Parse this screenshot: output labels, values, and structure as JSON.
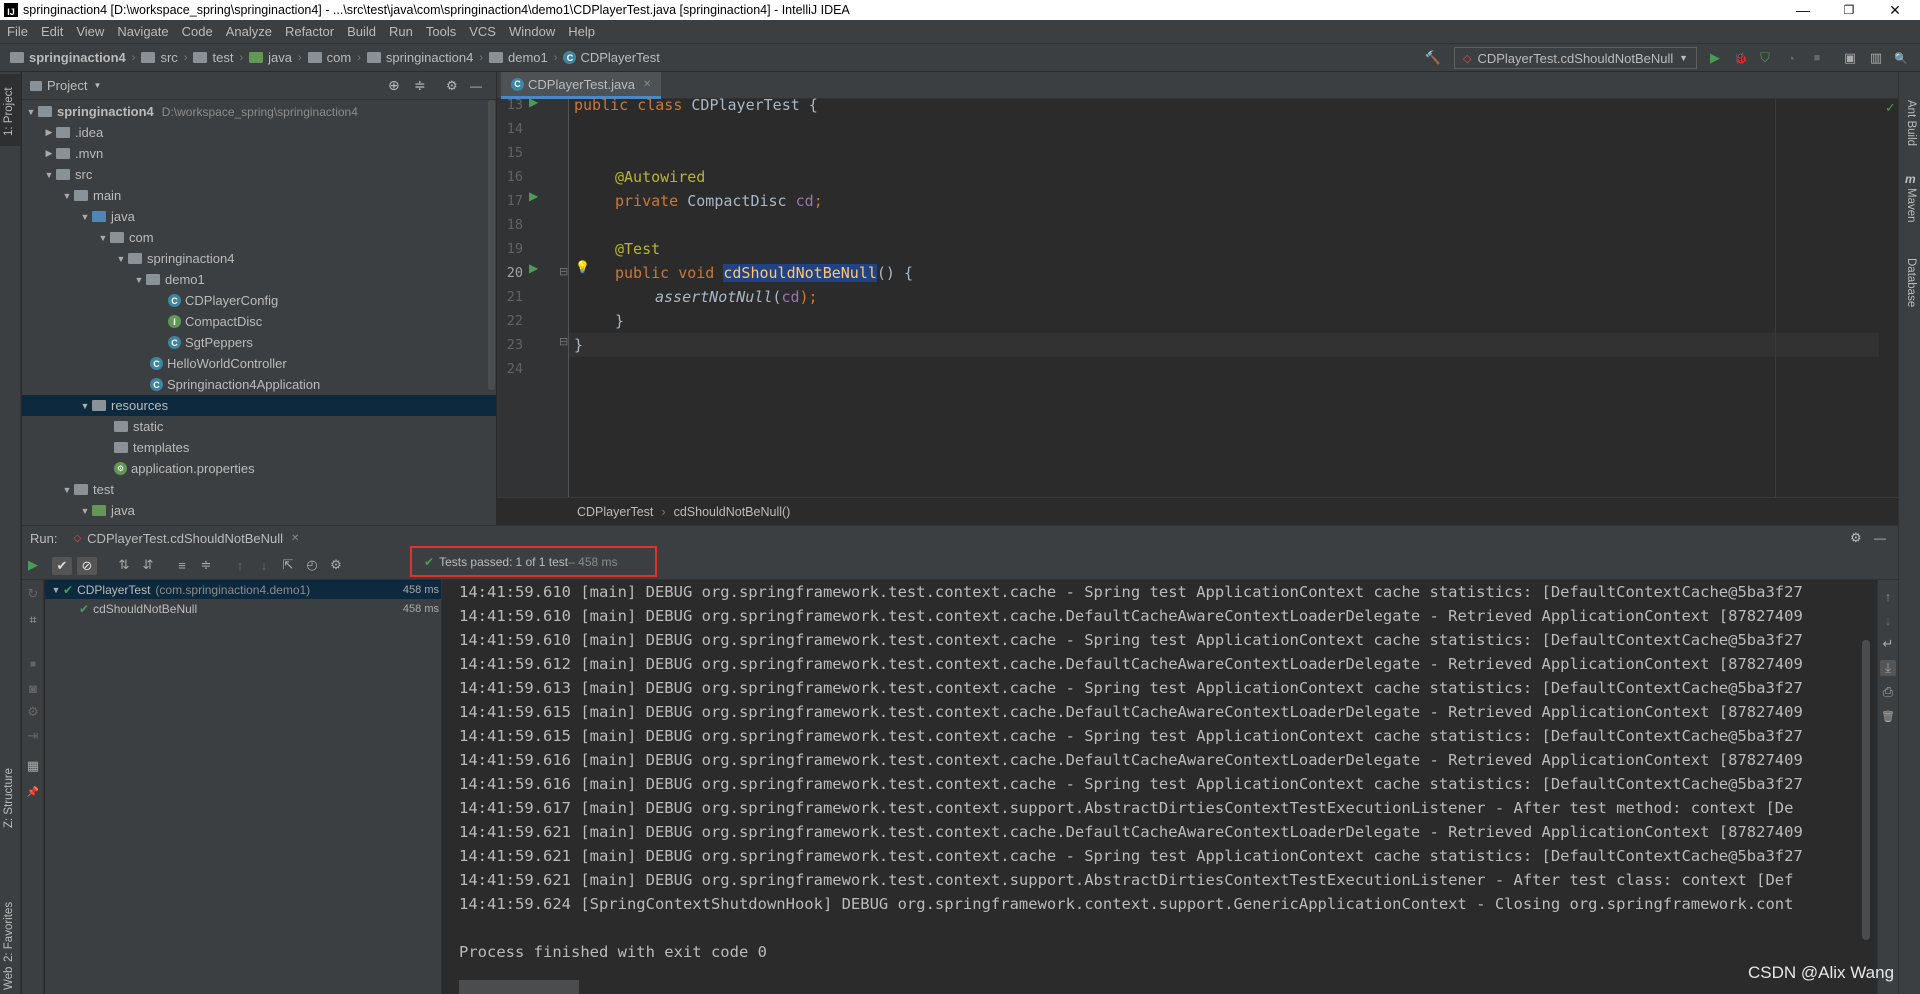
{
  "window": {
    "title": "springinaction4 [D:\\workspace_spring\\springinaction4] - ...\\src\\test\\java\\com\\springinaction4\\demo1\\CDPlayerTest.java [springinaction4] - IntelliJ IDEA",
    "logo_label": "IJ",
    "controls": {
      "minimize": "—",
      "maximize": "❐",
      "close": "✕"
    }
  },
  "menu": [
    "File",
    "Edit",
    "View",
    "Navigate",
    "Code",
    "Analyze",
    "Refactor",
    "Build",
    "Run",
    "Tools",
    "VCS",
    "Window",
    "Help"
  ],
  "breadcrumbs": [
    "springinaction4",
    "src",
    "test",
    "java",
    "com",
    "springinaction4",
    "demo1",
    "CDPlayerTest"
  ],
  "run_config": {
    "label": "CDPlayerTest.cdShouldNotBeNull",
    "icon": "◇",
    "dropdown": "▼"
  },
  "toolbar_icons": {
    "hammer": "🔨",
    "run": "▶",
    "debug": "🐞",
    "coverage": "⛉",
    "profile": "◔",
    "stop": "■",
    "project_structure": "▣",
    "layout": "▥",
    "settings": "⚙",
    "search": "🔍"
  },
  "left_strip": {
    "project": "1: Project",
    "structure": "Z: Structure",
    "favorites": "2: Favorites",
    "web": "Web"
  },
  "right_strip": {
    "ant": "Ant Build",
    "maven": "Maven",
    "database": "Database",
    "m_letter": "m"
  },
  "project_panel": {
    "title": "Project",
    "dropdown": "▼",
    "icons": {
      "target": "⊕",
      "collapse": "≑",
      "settings": "⚙",
      "hide": "—"
    },
    "tree": [
      {
        "arrow": "▼",
        "label": "springinaction4",
        "hint": "D:\\workspace_spring\\springinaction4",
        "kind": "module"
      },
      {
        "arrow": "▶",
        "label": ".idea",
        "kind": "folder"
      },
      {
        "arrow": "▶",
        "label": ".mvn",
        "kind": "folder"
      },
      {
        "arrow": "▼",
        "label": "src",
        "kind": "folder"
      },
      {
        "arrow": "▼",
        "label": "main",
        "kind": "folder"
      },
      {
        "arrow": "▼",
        "label": "java",
        "kind": "folder-blue"
      },
      {
        "arrow": "▼",
        "label": "com",
        "kind": "folder"
      },
      {
        "arrow": "▼",
        "label": "springinaction4",
        "kind": "folder"
      },
      {
        "arrow": "▼",
        "label": "demo1",
        "kind": "folder"
      },
      {
        "arrow": "",
        "label": "CDPlayerConfig",
        "kind": "class",
        "glyph": "C"
      },
      {
        "arrow": "",
        "label": "CompactDisc",
        "kind": "interface",
        "glyph": "I"
      },
      {
        "arrow": "",
        "label": "SgtPeppers",
        "kind": "class",
        "glyph": "C"
      },
      {
        "arrow": "",
        "label": "HelloWorldController",
        "kind": "class",
        "glyph": "C"
      },
      {
        "arrow": "",
        "label": "Springinaction4Application",
        "kind": "class",
        "glyph": "C"
      },
      {
        "arrow": "▼",
        "label": "resources",
        "kind": "folder",
        "selected": true
      },
      {
        "arrow": "",
        "label": "static",
        "kind": "folder"
      },
      {
        "arrow": "",
        "label": "templates",
        "kind": "folder"
      },
      {
        "arrow": "",
        "label": "application.properties",
        "kind": "file"
      },
      {
        "arrow": "▼",
        "label": "test",
        "kind": "folder"
      },
      {
        "arrow": "▼",
        "label": "java",
        "kind": "folder-blue"
      }
    ]
  },
  "editor": {
    "tab_label": "CDPlayerTest.java",
    "tab_close": "✕",
    "line_numbers": [
      "13",
      "14",
      "15",
      "16",
      "17",
      "18",
      "19",
      "20",
      "21",
      "22",
      "23",
      "24"
    ],
    "code": {
      "l13_kw1": "public ",
      "l13_kw2": "class ",
      "l13_rest": "CDPlayerTest {",
      "l16": "@Autowired",
      "l17_kw": "private ",
      "l17_type": "CompactDisc ",
      "l17_field": "cd",
      "l17_end": ";",
      "l19": "@Test",
      "l20_kw": "public void ",
      "l20_name": "cdShouldNotBeNull",
      "l20_end": "() {",
      "l21_call": "assertNotNull",
      "l21_open": "(",
      "l21_arg": "cd",
      "l21_end": ");",
      "l22": "}",
      "l23": "}"
    },
    "gutter_marks": {
      "run": "▶",
      "fold": "⊟",
      "bulb": "💡",
      "ok": "✓"
    },
    "breadcrumb": [
      "CDPlayerTest",
      "cdShouldNotBeNull()"
    ],
    "breadcrumb_sep": "›"
  },
  "run_panel": {
    "label": "Run:",
    "tab": "CDPlayerTest.cdShouldNotBeNull",
    "tab_close": "✕",
    "header_icons": {
      "settings": "⚙",
      "hide": "—"
    },
    "status_icon": "✔",
    "status_text": "Tests passed: ",
    "status_count": "1 of 1 test",
    "status_time": " – 458 ms",
    "toolbar_icons": {
      "run": "▶",
      "check": "✔",
      "stop": "⊘",
      "sort_alpha": "⇅",
      "sort_dur": "⇵",
      "expand": "≡",
      "collapse": "≑",
      "prev": "↑",
      "next": "↓",
      "export": "⇱",
      "history": "◴",
      "settings": "⚙"
    },
    "side_icons": {
      "rerun": "↻",
      "toggle": "⌗",
      "stop": "■",
      "camera": "◙",
      "gear": "⚙",
      "exit": "⇥",
      "layout": "▦",
      "pin": "📌"
    },
    "console_icons": {
      "up": "↑",
      "down": "↓",
      "wrap": "↵",
      "scroll_end": "⤓",
      "print": "⎙",
      "trash": "🗑"
    },
    "tests": [
      {
        "icon": "✔",
        "label": "CDPlayerTest",
        "pkg": "(com.springinaction4.demo1)",
        "time": "458 ms",
        "arrow": "▼"
      },
      {
        "icon": "✔",
        "label": "cdShouldNotBeNull",
        "time": "458 ms"
      }
    ],
    "console": [
      "14:41:59.610 [main] DEBUG org.springframework.test.context.cache - Spring test ApplicationContext cache statistics: [DefaultContextCache@5ba3f27",
      "14:41:59.610 [main] DEBUG org.springframework.test.context.cache.DefaultCacheAwareContextLoaderDelegate - Retrieved ApplicationContext [87827409",
      "14:41:59.610 [main] DEBUG org.springframework.test.context.cache - Spring test ApplicationContext cache statistics: [DefaultContextCache@5ba3f27",
      "14:41:59.612 [main] DEBUG org.springframework.test.context.cache.DefaultCacheAwareContextLoaderDelegate - Retrieved ApplicationContext [87827409",
      "14:41:59.613 [main] DEBUG org.springframework.test.context.cache - Spring test ApplicationContext cache statistics: [DefaultContextCache@5ba3f27",
      "14:41:59.615 [main] DEBUG org.springframework.test.context.cache.DefaultCacheAwareContextLoaderDelegate - Retrieved ApplicationContext [87827409",
      "14:41:59.615 [main] DEBUG org.springframework.test.context.cache - Spring test ApplicationContext cache statistics: [DefaultContextCache@5ba3f27",
      "14:41:59.616 [main] DEBUG org.springframework.test.context.cache.DefaultCacheAwareContextLoaderDelegate - Retrieved ApplicationContext [87827409",
      "14:41:59.616 [main] DEBUG org.springframework.test.context.cache - Spring test ApplicationContext cache statistics: [DefaultContextCache@5ba3f27",
      "14:41:59.617 [main] DEBUG org.springframework.test.context.support.AbstractDirtiesContextTestExecutionListener - After test method: context [De",
      "14:41:59.621 [main] DEBUG org.springframework.test.context.cache.DefaultCacheAwareContextLoaderDelegate - Retrieved ApplicationContext [87827409",
      "14:41:59.621 [main] DEBUG org.springframework.test.context.cache - Spring test ApplicationContext cache statistics: [DefaultContextCache@5ba3f27",
      "14:41:59.621 [main] DEBUG org.springframework.test.context.support.AbstractDirtiesContextTestExecutionListener - After test class: context [Def",
      "14:41:59.624 [SpringContextShutdownHook] DEBUG org.springframework.context.support.GenericApplicationContext - Closing org.springframework.cont",
      "",
      "Process finished with exit code 0"
    ]
  },
  "watermark": "CSDN @Alix Wang",
  "colors": {
    "passed_box": "#e0312b",
    "pass_green": "#499c54",
    "selection": "#214283",
    "accent": "#4a88c7"
  }
}
